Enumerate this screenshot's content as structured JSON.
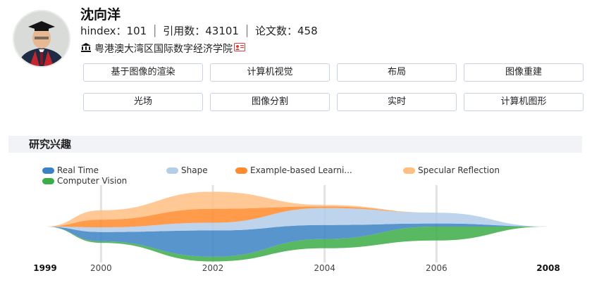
{
  "profile": {
    "name": "沈向洋",
    "hindex_label": "hindex：",
    "hindex_value": "101",
    "citations_label": "引用数：",
    "citations_value": "43101",
    "papers_label": "论文数：",
    "papers_value": "458",
    "affiliation": "粤港澳大湾区国际数字经济学院"
  },
  "tags": [
    "基于图像的渲染",
    "计算机视觉",
    "布局",
    "图像重建",
    "光场",
    "图像分割",
    "实时",
    "计算机图形"
  ],
  "chart_data": {
    "type": "area",
    "subtype": "streamgraph",
    "title": "研究兴趣",
    "x": [
      1999,
      2000,
      2002,
      2004,
      2006,
      2008
    ],
    "x_tick_labels": [
      "1999",
      "2000",
      "2002",
      "2004",
      "2006",
      "2008"
    ],
    "grid": true,
    "legend_position": "top-left",
    "series": [
      {
        "name": "Real Time",
        "color": "#3b82c4",
        "values": [
          0,
          0.6,
          1.7,
          0.9,
          0.2,
          0
        ]
      },
      {
        "name": "Shape",
        "color": "#b3cdea",
        "values": [
          0,
          0.3,
          0.5,
          1.1,
          0.7,
          0
        ]
      },
      {
        "name": "Example-based Learni...",
        "color": "#ff8a2b",
        "values": [
          0,
          0.5,
          0.9,
          0.1,
          0,
          0
        ]
      },
      {
        "name": "Specular Reflection",
        "color": "#ffbe82",
        "values": [
          0,
          0.6,
          1.1,
          0.1,
          0,
          0
        ]
      },
      {
        "name": "Computer Vision",
        "color": "#3cad47",
        "values": [
          0,
          0.1,
          0.3,
          0.6,
          0.9,
          0
        ]
      }
    ]
  }
}
